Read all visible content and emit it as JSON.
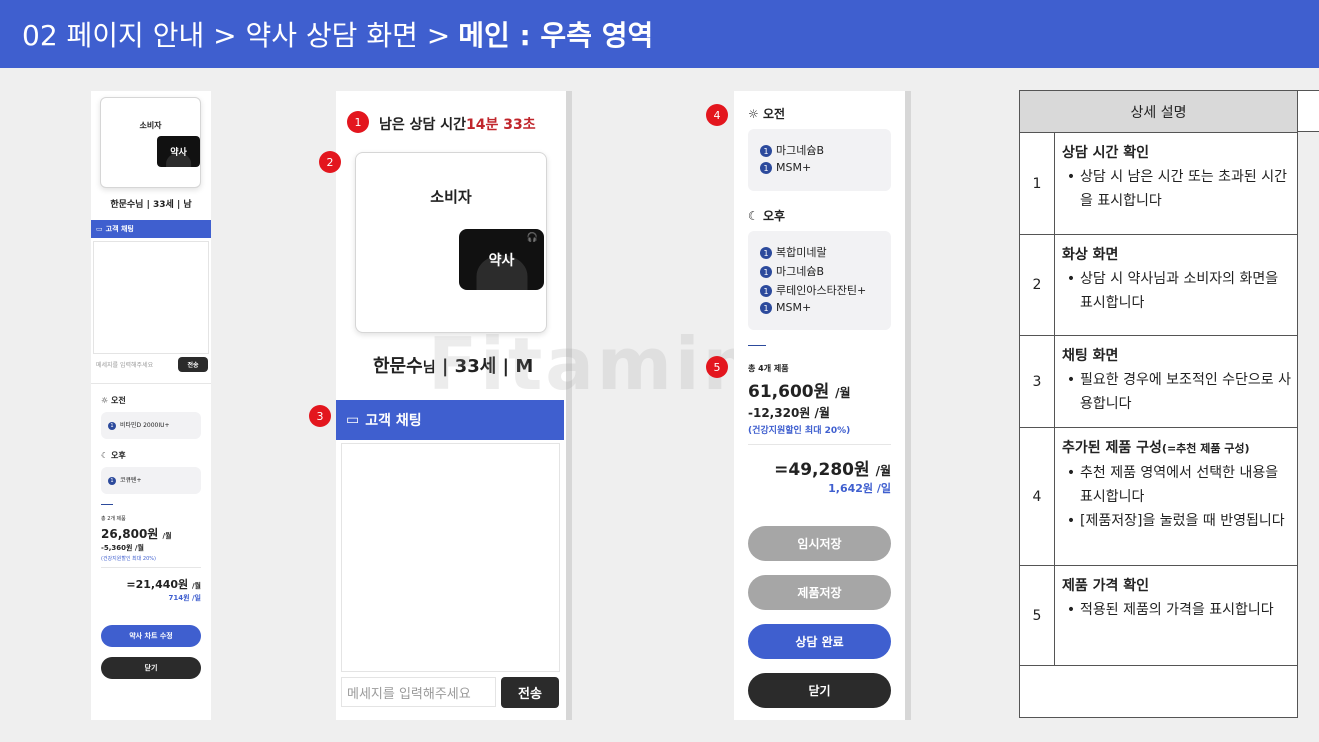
{
  "header": {
    "prefix": "02 페이지 안내 > 약사 상담 화면 >",
    "highlight": "메인 : 우측 영역"
  },
  "watermark": "Fitamin",
  "left_preview": {
    "consumer_label": "소비자",
    "pharmacist_label": "약사",
    "patient_info": "한문수님 | 33세 | 남",
    "chat_title": "고객 채팅",
    "chat_placeholder": "메세지를 입력해주세요",
    "send": "전송",
    "am_label": "오전",
    "am_items": [
      "비타민D 2000IU+"
    ],
    "pm_label": "오후",
    "pm_items": [
      "코큐텐+"
    ],
    "count": "총 2개 제품",
    "price": "26,800원",
    "price_unit": "/월",
    "discount": "-5,360원 /월",
    "discount_note": "(건강지원할인 최대 20%)",
    "final": "=21,440원",
    "final_unit": "/월",
    "per_day": "714원 /일",
    "edit_btn": "약사 차트 수정",
    "close_btn": "닫기"
  },
  "middle": {
    "badge1": "1",
    "time_label": "남은 상담 시간",
    "time_value": "14분 33초",
    "badge2": "2",
    "consumer_label": "소비자",
    "pharmacist_label": "약사",
    "patient_name": "한문수",
    "patient_suffix": "님",
    "patient_rest": " | 33세 | M",
    "badge3": "3",
    "chat_title": "고객 채팅",
    "chat_placeholder": "메세지를 입력해주세요",
    "send": "전송"
  },
  "right": {
    "badge4": "4",
    "am_label": "오전",
    "am_items": [
      "마그네슘B",
      "MSM+"
    ],
    "pm_label": "오후",
    "pm_items": [
      "복합미네랄",
      "마그네슘B",
      "루테인아스타잔틴+",
      "MSM+"
    ],
    "badge5": "5",
    "count": "총 4개 제품",
    "price": "61,600원",
    "price_unit": "/월",
    "discount": "-12,320원 /월",
    "discount_note": "(건강지원할인 최대 20%)",
    "final": "=49,280원",
    "final_unit": "/월",
    "per_day": "1,642원 /일",
    "btn_temp": "임시저장",
    "btn_save": "제품저장",
    "btn_done": "상담 완료",
    "btn_close": "닫기"
  },
  "table": {
    "header": "상세 설명",
    "rows": [
      {
        "n": "1",
        "title": "상담 시간 확인",
        "title_small": "",
        "bullets": [
          "상담 시 남은 시간 또는 초과된 시간을 표시합니다"
        ]
      },
      {
        "n": "2",
        "title": "화상 화면",
        "title_small": "",
        "bullets": [
          "상담 시 약사님과 소비자의 화면을 표시합니다"
        ]
      },
      {
        "n": "3",
        "title": "채팅 화면",
        "title_small": "",
        "bullets": [
          "필요한 경우에 보조적인 수단으로 사용합니다"
        ]
      },
      {
        "n": "4",
        "title": "추가된 제품 구성",
        "title_small": "(=추천 제품 구성)",
        "bullets": [
          "추천 제품 영역에서 선택한 내용을 표시합니다",
          "[제품저장]을 눌렀을 때 반영됩니다"
        ]
      },
      {
        "n": "5",
        "title": "제품 가격 확인",
        "title_small": "",
        "bullets": [
          "적용된 제품의 가격을 표시합니다"
        ]
      }
    ]
  },
  "colors": {
    "accent": "#3f5fcf",
    "badge": "#e3161e",
    "time_red": "#c0262c",
    "dark": "#2b2b2b",
    "grey_btn": "#a6a6a6"
  }
}
